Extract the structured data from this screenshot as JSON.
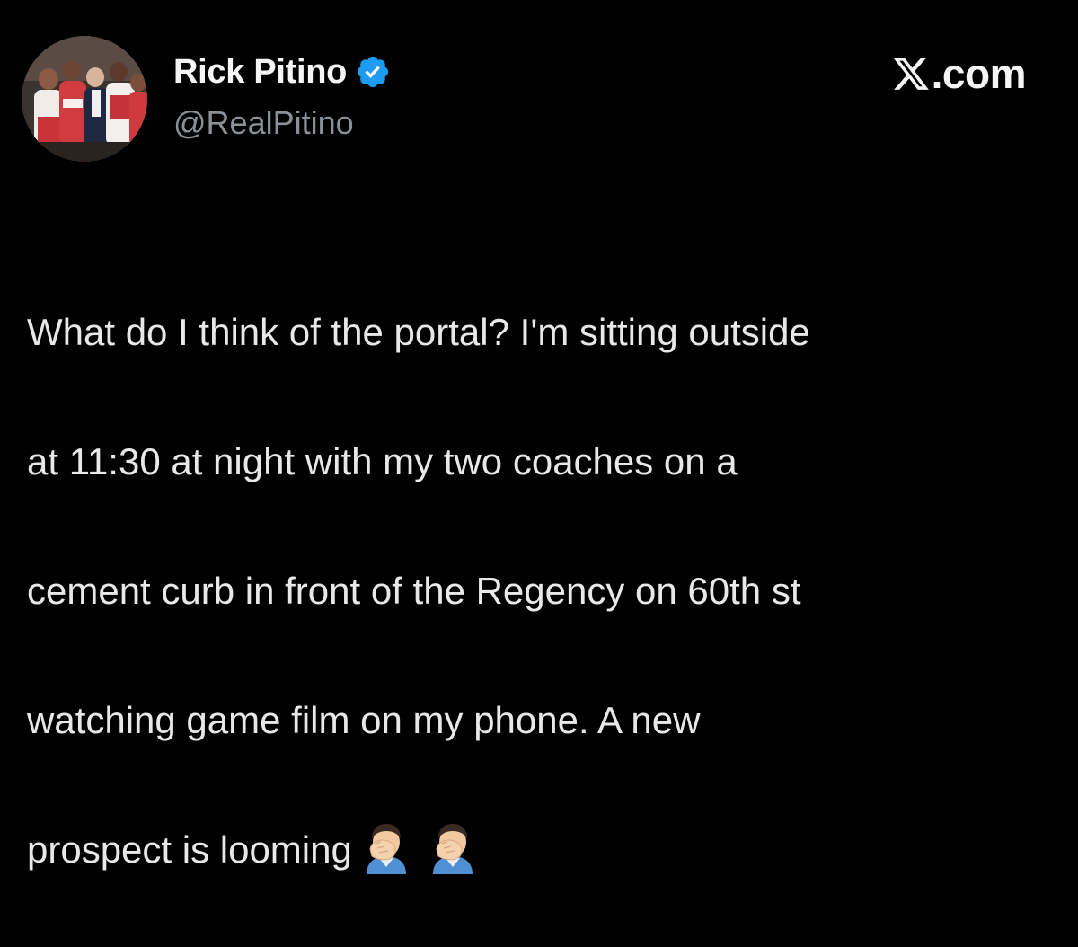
{
  "tweet": {
    "author": {
      "display_name": "Rick Pitino",
      "handle": "@RealPitino",
      "verified": true,
      "avatar_icon": "avatar-team-huddle"
    },
    "brand": {
      "logo_icon": "x-logo-icon",
      "text": ".com"
    },
    "text_lines": [
      "What do I think of the portal? I'm sitting outside",
      "at 11:30 at night with my two coaches on a",
      "cement curb in front of the Regency on 60th st",
      "watching game film on my phone. A new",
      "prospect is looming"
    ],
    "emojis": [
      "facepalm-icon",
      "facepalm-icon"
    ]
  },
  "colors": {
    "background": "#000000",
    "text": "#e8e8e8",
    "muted": "#8b9197",
    "verified_blue": "#1d9bf0"
  }
}
